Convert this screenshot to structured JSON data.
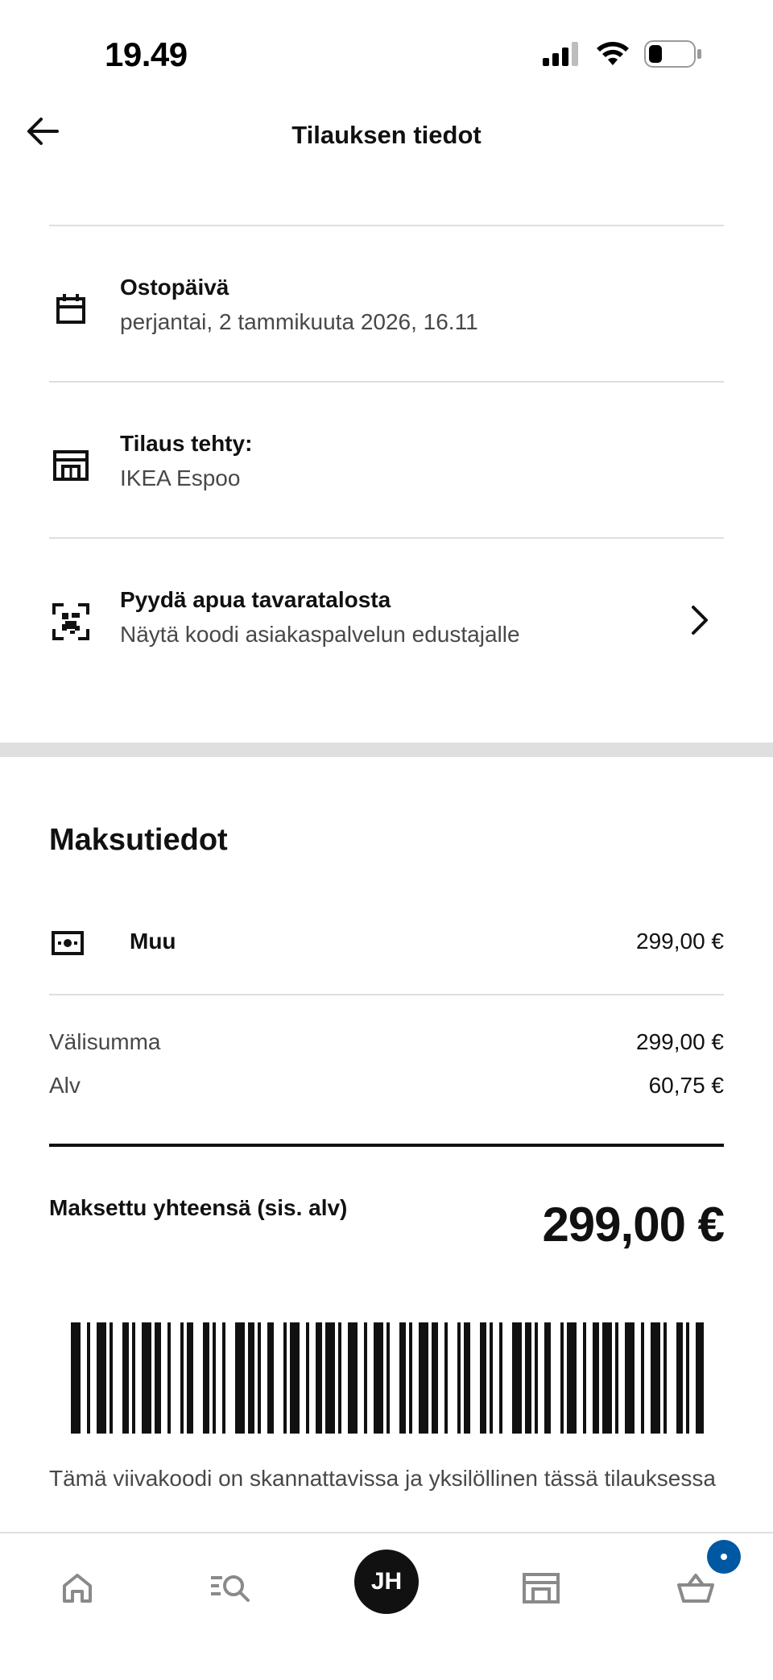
{
  "status_bar": {
    "time": "19.49",
    "icons": [
      "cellular-signal-icon",
      "wifi-icon",
      "battery-icon"
    ]
  },
  "header": {
    "title": "Tilauksen tiedot",
    "back_icon": "arrow-left-icon"
  },
  "info_rows": [
    {
      "icon": "calendar-icon",
      "title": "Ostopäivä",
      "subtitle": "perjantai, 2 tammikuuta 2026, 16.11"
    },
    {
      "icon": "store-icon",
      "title": "Tilaus tehty:",
      "subtitle": "IKEA Espoo"
    },
    {
      "icon": "qr-code-icon",
      "title": "Pyydä apua tavaratalosta",
      "subtitle": "Näytä koodi asiakaspalvelun edustajalle",
      "chevron_icon": "chevron-right-icon"
    }
  ],
  "payment": {
    "section_title": "Maksutiedot",
    "method": {
      "icon": "cash-icon",
      "label": "Muu",
      "amount": "299,00 €"
    },
    "subtotal_label": "Välisumma",
    "subtotal_value": "299,00 €",
    "vat_label": "Alv",
    "vat_value": "60,75 €",
    "total_label": "Maksettu yhteensä (sis. alv)",
    "total_value": "299,00 €"
  },
  "barcode": {
    "note": "Tämä viivakoodi on skannattavissa ja yksilöllinen tässä tilauksessa"
  },
  "bottom_nav": {
    "items": [
      "home-icon",
      "search-list-icon",
      "profile-avatar",
      "store-icon",
      "basket-icon"
    ],
    "avatar_initials": "JH",
    "accent_color": "#0058a3"
  },
  "colors": {
    "text": "#111111",
    "muted": "#484848",
    "divider": "#dfdfdf",
    "badge": "#0058a3"
  }
}
